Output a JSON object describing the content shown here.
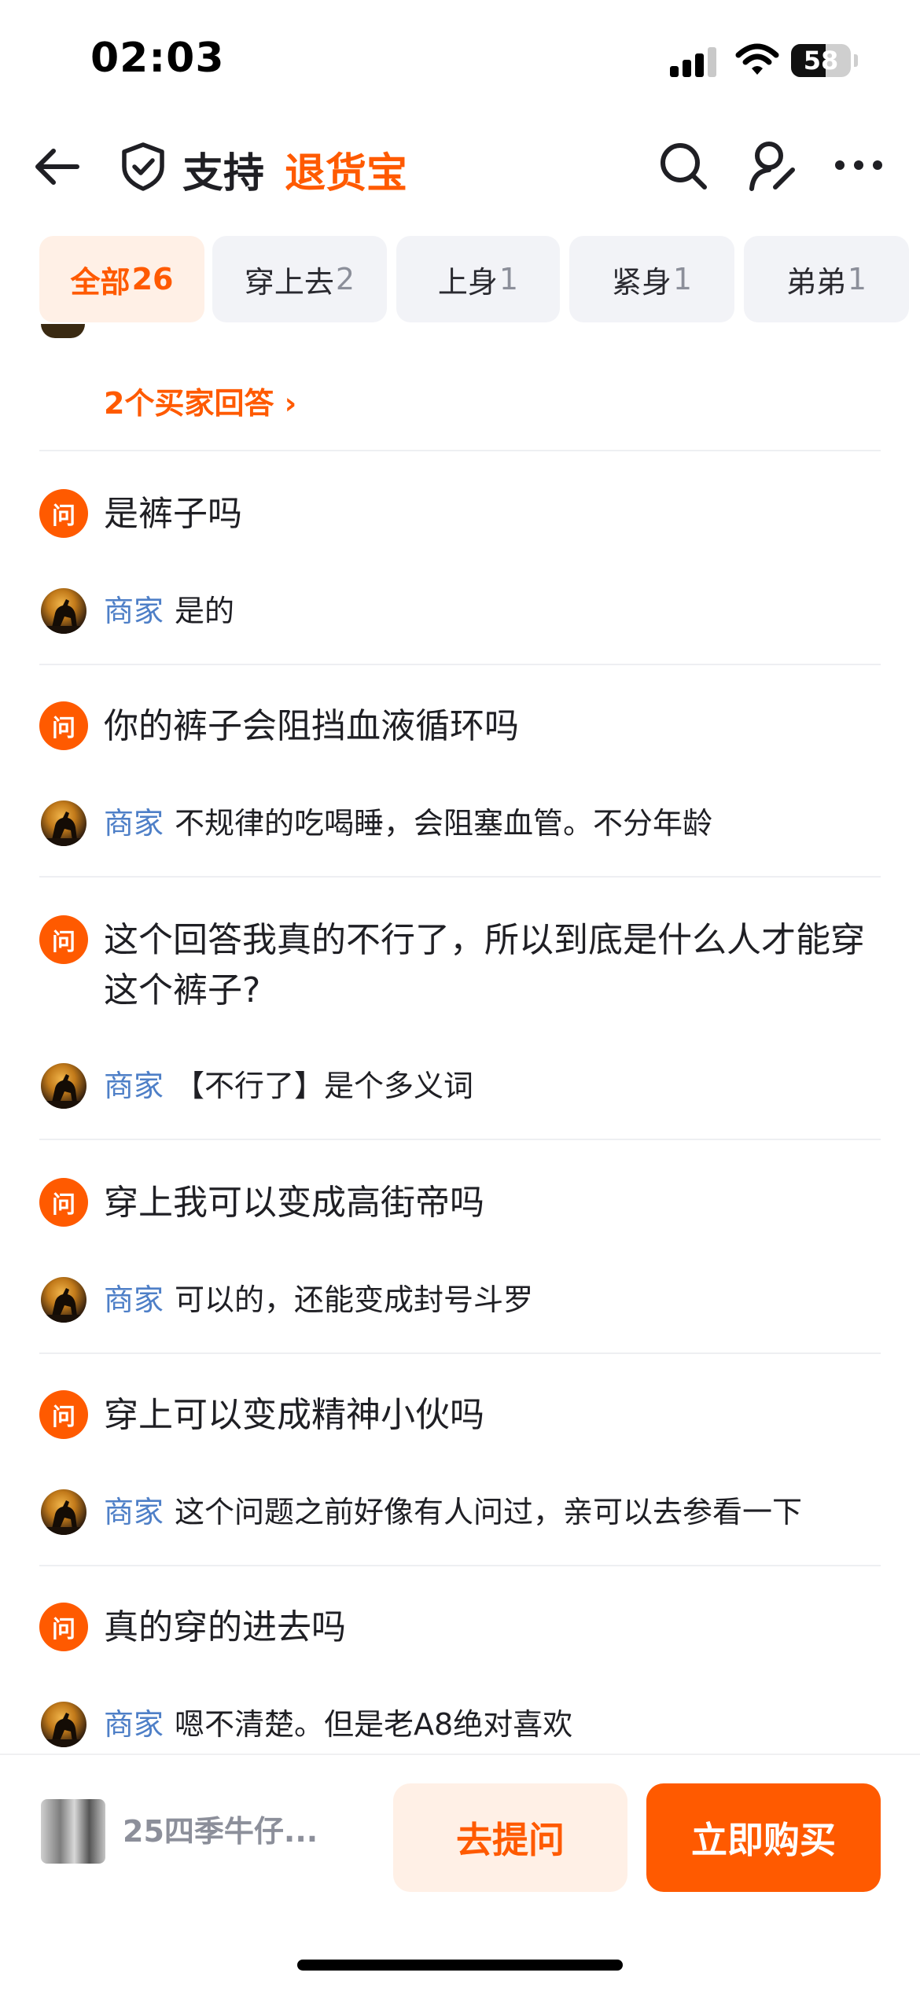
{
  "status_bar": {
    "time": "02:03",
    "battery": "58",
    "battery_level": 0.58
  },
  "nav": {
    "title": "支持",
    "title_accent": "退货宝"
  },
  "tabs": [
    {
      "label": "全部",
      "count": "26",
      "active": true
    },
    {
      "label": "穿上去",
      "count": "2",
      "active": false
    },
    {
      "label": "上身",
      "count": "1",
      "active": false
    },
    {
      "label": "紧身",
      "count": "1",
      "active": false
    },
    {
      "label": "弟弟",
      "count": "1",
      "active": false
    }
  ],
  "list": {
    "more_answers_link": "2个买家回答 ›",
    "question_badge": "问",
    "merchant_label": "商家",
    "items": [
      {
        "question": "是裤子吗",
        "answer": "是的"
      },
      {
        "question": "你的裤子会阻挡血液循环吗",
        "answer": "不规律的吃喝睡，会阻塞血管。不分年龄"
      },
      {
        "question": "这个回答我真的不行了，所以到底是什么人才能穿这个裤子?",
        "answer": "【不行了】是个多义词"
      },
      {
        "question": "穿上我可以变成高街帝吗",
        "answer": "可以的，还能变成封号斗罗"
      },
      {
        "question": "穿上可以变成精神小伙吗",
        "answer": "这个问题之前好像有人问过，亲可以去参看一下"
      },
      {
        "question": "真的穿的进去吗",
        "answer": "嗯不清楚。但是老A8绝对喜欢"
      }
    ]
  },
  "bottom_bar": {
    "product_name": "25四季牛仔...",
    "ask_button": "去提问",
    "buy_button": "立即购买"
  },
  "colors": {
    "accent": "#ff5a00",
    "accent_soft": "#fff0e6",
    "merchant_blue": "#4e7fc7",
    "tab_bg": "#f2f3f7"
  },
  "icons": [
    "back-arrow-icon",
    "shield-check-icon",
    "search-icon",
    "user-edit-icon",
    "more-dots-icon",
    "signal-icon",
    "wifi-icon",
    "battery-icon"
  ]
}
